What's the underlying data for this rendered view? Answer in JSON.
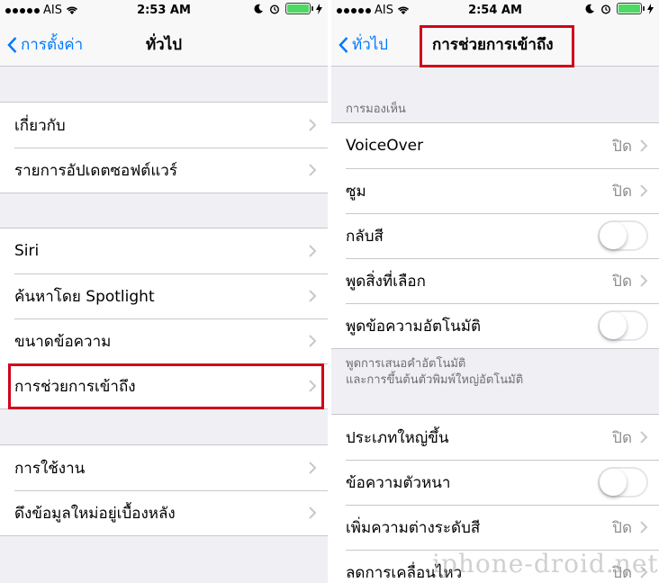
{
  "colors": {
    "accent": "#007aff",
    "highlight": "#d0021b",
    "battery": "#4cd964"
  },
  "left": {
    "status": {
      "carrier": "AIS",
      "time": "2:53 AM"
    },
    "nav": {
      "back_label": "การตั้งค่า",
      "title": "ทั่วไป"
    },
    "groups": [
      {
        "items": [
          {
            "label": "เกี่ยวกับ"
          },
          {
            "label": "รายการอัปเดตซอฟต์แวร์"
          }
        ]
      },
      {
        "items": [
          {
            "label": "Siri"
          },
          {
            "label": "ค้นหาโดย Spotlight"
          },
          {
            "label": "ขนาดข้อความ"
          },
          {
            "label": "การช่วยการเข้าถึง"
          }
        ]
      },
      {
        "items": [
          {
            "label": "การใช้งาน"
          },
          {
            "label": "ดึงข้อมูลใหม่อยู่เบื้องหลัง"
          }
        ]
      }
    ]
  },
  "right": {
    "status": {
      "carrier": "AIS",
      "time": "2:54 AM"
    },
    "nav": {
      "back_label": "ทั่วไป",
      "title": "การช่วยการเข้าถึง"
    },
    "section_header": "การมองเห็น",
    "group1": [
      {
        "label": "VoiceOver",
        "value": "ปิด"
      },
      {
        "label": "ซูม",
        "value": "ปิด"
      },
      {
        "label": "กลับสี",
        "toggle": false
      },
      {
        "label": "พูดสิ่งที่เลือก",
        "value": "ปิด"
      },
      {
        "label": "พูดข้อความอัตโนมัติ",
        "toggle": false
      }
    ],
    "footer": {
      "line1": "พูดการเสนอคำอัตโนมัติ",
      "line2": "และการขึ้นต้นตัวพิมพ์ใหญ่อัตโนมัติ"
    },
    "group2": [
      {
        "label": "ประเภทใหญ่ขึ้น",
        "value": "ปิด"
      },
      {
        "label": "ข้อความตัวหนา",
        "toggle": false
      },
      {
        "label": "เพิ่มความต่างระดับสี",
        "value": "ปิด"
      },
      {
        "label": "ลดการเคลื่อนไหว",
        "value": "ปิด"
      }
    ]
  },
  "watermark": "iphone-droid.net"
}
